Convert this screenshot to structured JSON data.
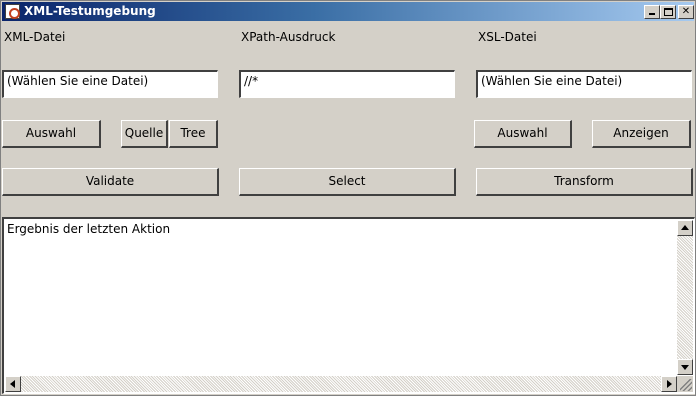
{
  "window": {
    "title": "XML-Testumgebung"
  },
  "xml": {
    "label": "XML-Datei",
    "value": "(Wählen Sie eine Datei)",
    "choose_button": "Auswahl",
    "source_button": "Quelle",
    "tree_button": "Tree",
    "validate_button": "Validate"
  },
  "xpath": {
    "label": "XPath-Ausdruck",
    "value": "//*",
    "select_button": "Select"
  },
  "xsl": {
    "label": "XSL-Datei",
    "value": "(Wählen Sie eine Datei)",
    "choose_button": "Auswahl",
    "show_button": "Anzeigen",
    "transform_button": "Transform"
  },
  "result": {
    "text": "Ergebnis der letzten Aktion"
  },
  "colors": {
    "titlebar_start": "#0a246a",
    "titlebar_end": "#a6caf0",
    "window_bg": "#d4d0c8"
  },
  "icons": {
    "app": "java-cup-icon",
    "minimize": "minimize-icon",
    "maximize": "maximize-icon",
    "close": "close-icon"
  }
}
